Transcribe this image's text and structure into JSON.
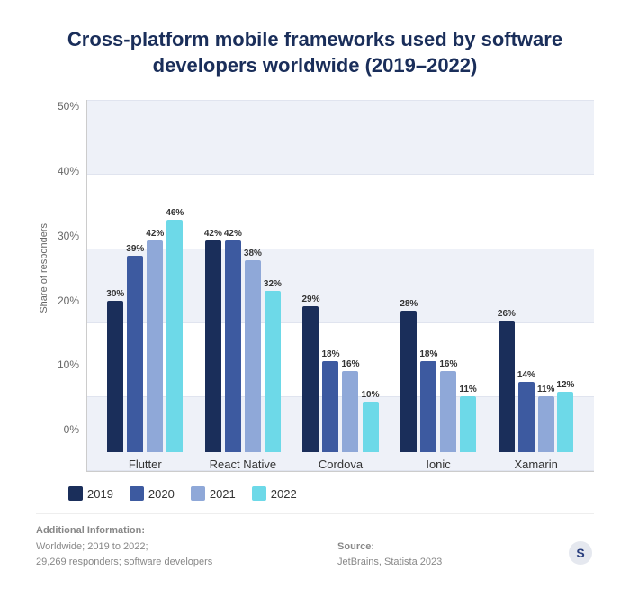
{
  "title": "Cross-platform mobile frameworks used by\nsoftware developers worldwide (2019–2022)",
  "yAxis": {
    "label": "Share of responders",
    "ticks": [
      "0%",
      "10%",
      "20%",
      "30%",
      "40%",
      "50%"
    ]
  },
  "maxValue": 50,
  "groups": [
    {
      "label": "Flutter",
      "bars": [
        {
          "year": 2019,
          "value": 30,
          "label": "30%"
        },
        {
          "year": 2020,
          "value": 39,
          "label": "39%"
        },
        {
          "year": 2021,
          "value": 42,
          "label": "42%"
        },
        {
          "year": 2022,
          "value": 46,
          "label": "46%"
        }
      ]
    },
    {
      "label": "React Native",
      "bars": [
        {
          "year": 2019,
          "value": 42,
          "label": "42%"
        },
        {
          "year": 2020,
          "value": 42,
          "label": "42%"
        },
        {
          "year": 2021,
          "value": 38,
          "label": "38%"
        },
        {
          "year": 2022,
          "value": 32,
          "label": "32%"
        }
      ]
    },
    {
      "label": "Cordova",
      "bars": [
        {
          "year": 2019,
          "value": 29,
          "label": "29%"
        },
        {
          "year": 2020,
          "value": 18,
          "label": "18%"
        },
        {
          "year": 2021,
          "value": 16,
          "label": "16%"
        },
        {
          "year": 2022,
          "value": 10,
          "label": "10%"
        }
      ]
    },
    {
      "label": "Ionic",
      "bars": [
        {
          "year": 2019,
          "value": 28,
          "label": "28%"
        },
        {
          "year": 2020,
          "value": 18,
          "label": "18%"
        },
        {
          "year": 2021,
          "value": 16,
          "label": "16%"
        },
        {
          "year": 2022,
          "value": 11,
          "label": "11%"
        }
      ]
    },
    {
      "label": "Xamarin",
      "bars": [
        {
          "year": 2019,
          "value": 26,
          "label": "26%"
        },
        {
          "year": 2020,
          "value": 14,
          "label": "14%"
        },
        {
          "year": 2021,
          "value": 11,
          "label": "11%"
        },
        {
          "year": 2022,
          "value": 12,
          "label": "12%"
        }
      ]
    }
  ],
  "legend": [
    {
      "year": "2019",
      "colorClass": "c2019"
    },
    {
      "year": "2020",
      "colorClass": "c2020"
    },
    {
      "year": "2021",
      "colorClass": "c2021"
    },
    {
      "year": "2022",
      "colorClass": "c2022"
    }
  ],
  "footer": {
    "additionalLabel": "Additional Information:",
    "additionalLines": [
      "Worldwide; 2019 to 2022;",
      "29,269 responders; software developers"
    ],
    "sourceLabel": "Source:",
    "sourceValue": "JetBrains, Statista 2023"
  }
}
